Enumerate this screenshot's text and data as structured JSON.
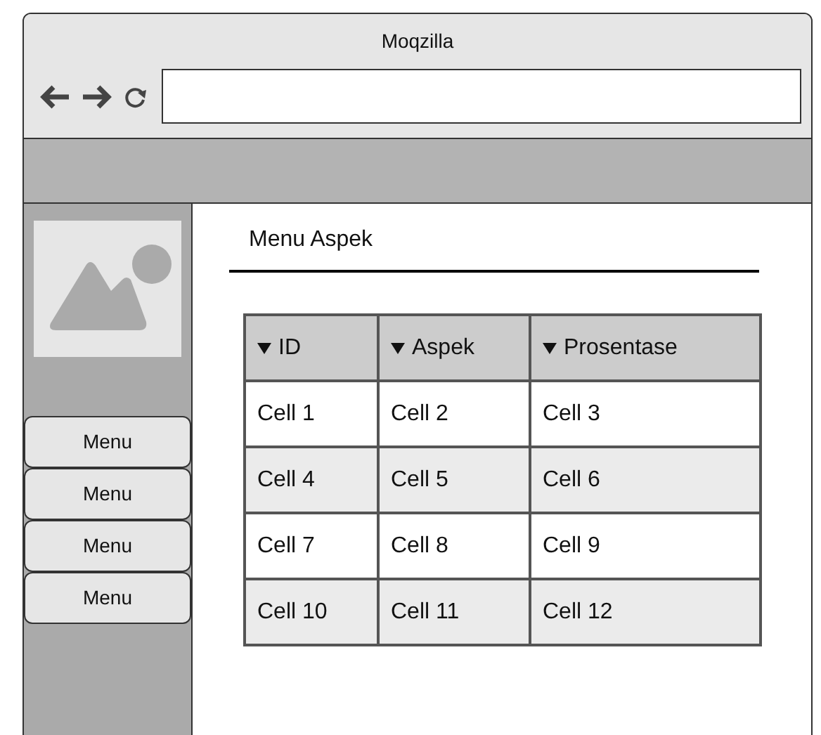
{
  "window": {
    "title": "Moqzilla"
  },
  "sidebar": {
    "menu_items": [
      "Menu",
      "Menu",
      "Menu",
      "Menu"
    ]
  },
  "content": {
    "heading": "Menu Aspek"
  },
  "table": {
    "columns": [
      "ID",
      "Aspek",
      "Prosentase"
    ],
    "rows": [
      [
        "Cell 1",
        "Cell 2",
        "Cell 3"
      ],
      [
        "Cell 4",
        "Cell 5",
        "Cell 6"
      ],
      [
        "Cell 7",
        "Cell 8",
        "Cell 9"
      ],
      [
        "Cell 10",
        "Cell 11",
        "Cell 12"
      ]
    ]
  }
}
